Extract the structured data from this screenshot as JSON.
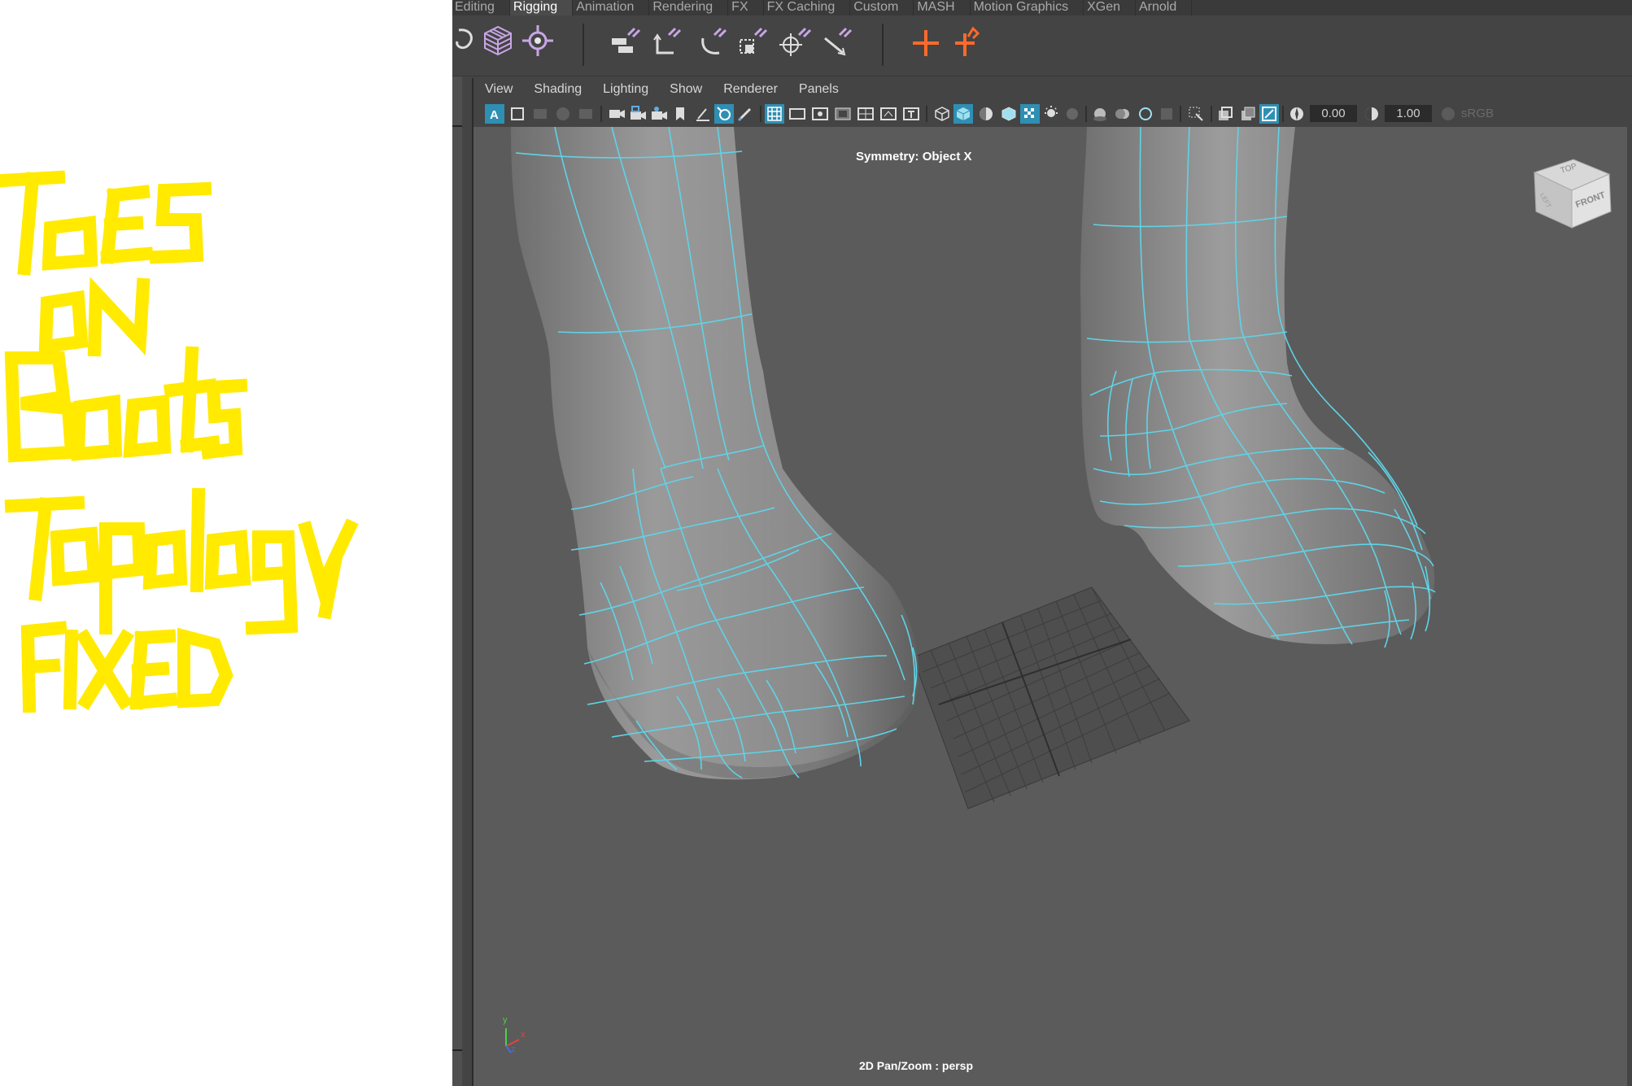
{
  "annotation": {
    "lines": [
      "ToES",
      "ON",
      "Boots",
      "Topology",
      "FIXED"
    ],
    "color": "#ffea00"
  },
  "shelf": {
    "tabs": [
      {
        "label": "Editing",
        "active": false
      },
      {
        "label": "Rigging",
        "active": true
      },
      {
        "label": "Animation",
        "active": false
      },
      {
        "label": "Rendering",
        "active": false
      },
      {
        "label": "FX",
        "active": false
      },
      {
        "label": "FX Caching",
        "active": false
      },
      {
        "label": "Custom",
        "active": false
      },
      {
        "label": "MASH",
        "active": false
      },
      {
        "label": "Motion Graphics",
        "active": false
      },
      {
        "label": "XGen",
        "active": false
      },
      {
        "label": "Arnold",
        "active": false
      }
    ]
  },
  "panel": {
    "menu": [
      "View",
      "Shading",
      "Lighting",
      "Show",
      "Renderer",
      "Panels"
    ],
    "exposure": "0.00",
    "gamma": "1.00",
    "color_space": "sRGB gamma"
  },
  "viewport": {
    "symmetry": "Symmetry: Object X",
    "camera_status": "2D Pan/Zoom : persp",
    "view_cube": {
      "top": "TOP",
      "front": "FRONT",
      "left": "LEFT"
    },
    "wire_color": "#5fd3e6",
    "axis": {
      "x": "x",
      "y": "y",
      "z": "z"
    }
  }
}
